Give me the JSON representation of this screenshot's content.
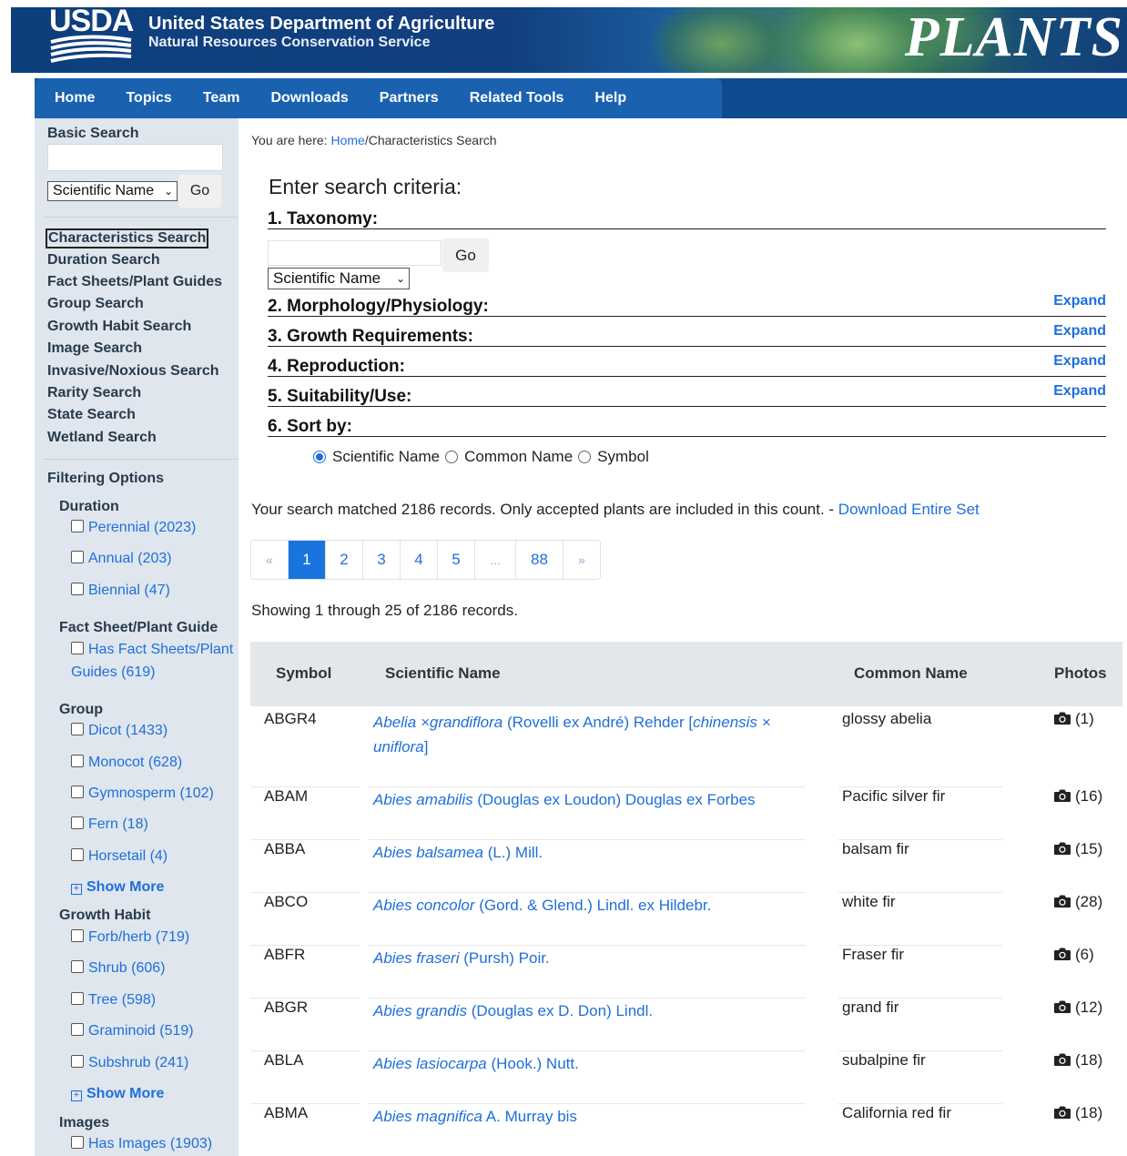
{
  "header": {
    "logo_text": "USDA",
    "department": "United States Department of Agriculture",
    "service": "Natural Resources Conservation Service",
    "site_name": "PLANTS"
  },
  "nav": {
    "tabs": [
      "Home",
      "Topics",
      "Team",
      "Downloads",
      "Partners",
      "Related Tools",
      "Help"
    ]
  },
  "sidebar": {
    "basic_search": {
      "title": "Basic Search",
      "input_value": "",
      "select_value": "Scientific Name",
      "go_label": "Go"
    },
    "links": [
      "Characteristics Search",
      "Duration Search",
      "Fact Sheets/Plant Guides",
      "Group Search",
      "Growth Habit Search",
      "Image Search",
      "Invasive/Noxious Search",
      "Rarity Search",
      "State Search",
      "Wetland Search"
    ],
    "filtering_title": "Filtering Options",
    "duration": {
      "title": "Duration",
      "items": [
        "Perennial (2023)",
        "Annual (203)",
        "Biennial (47)"
      ]
    },
    "factsheet": {
      "title": "Fact Sheet/Plant Guide",
      "item_line1": "Has Fact Sheets/Plant",
      "item_line2": "Guides (619)"
    },
    "group": {
      "title": "Group",
      "items": [
        "Dicot (1433)",
        "Monocot (628)",
        "Gymnosperm (102)",
        "Fern (18)",
        "Horsetail (4)"
      ],
      "show_more": "Show More"
    },
    "growth_habit": {
      "title": "Growth Habit",
      "items": [
        "Forb/herb (719)",
        "Shrub (606)",
        "Tree (598)",
        "Graminoid (519)",
        "Subshrub (241)"
      ],
      "show_more": "Show More"
    },
    "images": {
      "title": "Images",
      "items": [
        "Has Images (1903)"
      ]
    }
  },
  "main": {
    "breadcrumb": {
      "prefix": "You are here: ",
      "home": "Home",
      "current": "/Characteristics Search"
    },
    "enter_title": "Enter search criteria:",
    "sections": {
      "taxonomy": "1. Taxonomy:",
      "morphology": "2. Morphology/Physiology:",
      "growth": "3. Growth Requirements:",
      "reproduction": "4. Reproduction:",
      "suitability": "5. Suitability/Use:",
      "sort": "6. Sort by:",
      "expand_label": "Expand"
    },
    "taxonomy": {
      "input_value": "",
      "go_label": "Go",
      "select_value": "Scientific Name"
    },
    "sort_options": [
      "Scientific Name",
      "Common Name",
      "Symbol"
    ],
    "sort_selected": "Scientific Name",
    "matched_text": "Your search matched 2186 records. Only accepted plants are included in this count. - ",
    "download_link": "Download Entire Set",
    "pager": [
      "«",
      "1",
      "2",
      "3",
      "4",
      "5",
      "...",
      "88",
      "»"
    ],
    "pager_active": "1",
    "showing_text": "Showing 1 through 25 of 2186 records.",
    "table": {
      "headers": [
        "Symbol",
        "Scientific Name",
        "Common Name",
        "Photos"
      ],
      "rows": [
        {
          "symbol": "ABGR4",
          "sci_italic": "Abelia ×grandiflora",
          "sci_author": " (Rovelli ex André) Rehder [",
          "sci_italic2": "chinensis × uniflora",
          "sci_end": "]",
          "common": "glossy abelia",
          "photos": "(1)"
        },
        {
          "symbol": "ABAM",
          "sci_italic": "Abies amabilis",
          "sci_author": " (Douglas ex Loudon) Douglas ex Forbes",
          "sci_italic2": "",
          "sci_end": "",
          "common": "Pacific silver fir",
          "photos": "(16)"
        },
        {
          "symbol": "ABBA",
          "sci_italic": "Abies balsamea",
          "sci_author": " (L.) Mill.",
          "sci_italic2": "",
          "sci_end": "",
          "common": "balsam fir",
          "photos": "(15)"
        },
        {
          "symbol": "ABCO",
          "sci_italic": "Abies concolor",
          "sci_author": " (Gord. & Glend.) Lindl. ex Hildebr.",
          "sci_italic2": "",
          "sci_end": "",
          "common": "white fir",
          "photos": "(28)"
        },
        {
          "symbol": "ABFR",
          "sci_italic": "Abies fraseri",
          "sci_author": " (Pursh) Poir.",
          "sci_italic2": "",
          "sci_end": "",
          "common": "Fraser fir",
          "photos": "(6)"
        },
        {
          "symbol": "ABGR",
          "sci_italic": "Abies grandis",
          "sci_author": " (Douglas ex D. Don) Lindl.",
          "sci_italic2": "",
          "sci_end": "",
          "common": "grand fir",
          "photos": "(12)"
        },
        {
          "symbol": "ABLA",
          "sci_italic": "Abies lasiocarpa",
          "sci_author": " (Hook.) Nutt.",
          "sci_italic2": "",
          "sci_end": "",
          "common": "subalpine fir",
          "photos": "(18)"
        },
        {
          "symbol": "ABMA",
          "sci_italic": "Abies magnifica",
          "sci_author": " A. Murray bis",
          "sci_italic2": "",
          "sci_end": "",
          "common": "California red fir",
          "photos": "(18)"
        }
      ]
    }
  },
  "colors": {
    "header_blue": "#0d3f7d",
    "nav_blue": "#1a62b0",
    "sidebar_bg": "#dfe6ee",
    "link_blue": "#1e6fd9",
    "pager_active": "#1a74e0"
  },
  "icons": {
    "camera": "camera-icon",
    "show_more": "plus-square-icon",
    "select": "chevron-down-icon"
  }
}
